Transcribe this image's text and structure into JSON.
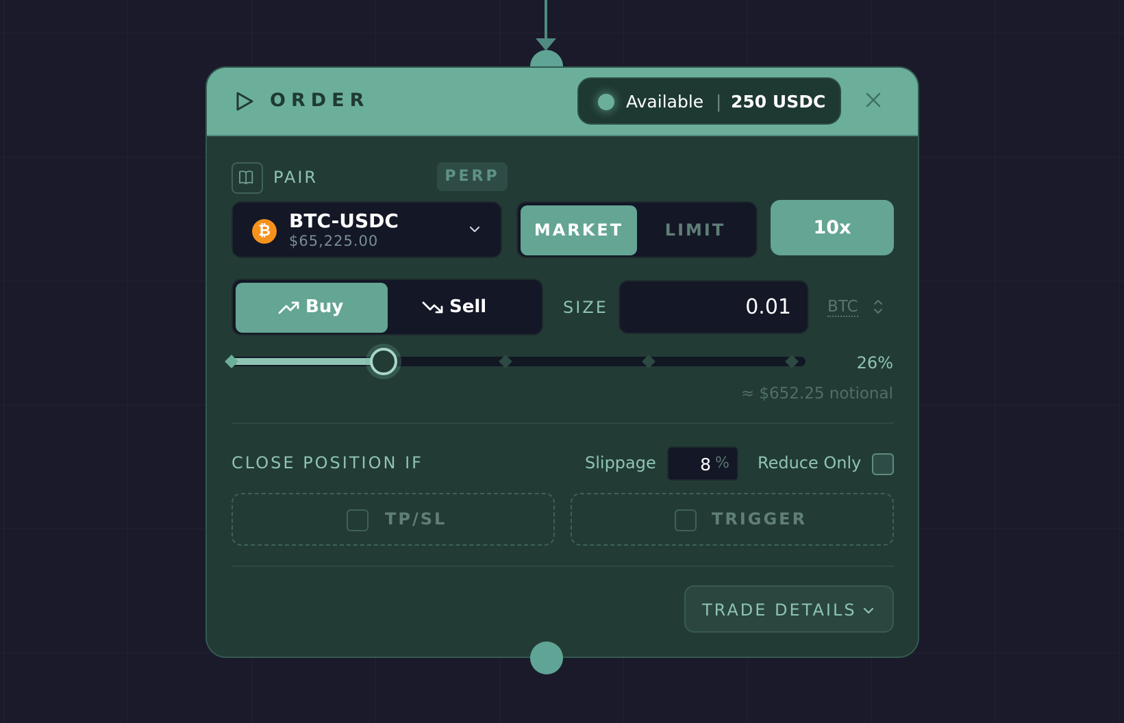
{
  "header": {
    "title": "ORDER",
    "available_label": "Available",
    "available_separator": "|",
    "available_value": "250 USDC"
  },
  "pair": {
    "label": "PAIR",
    "market_type": "PERP",
    "symbol": "BTC-USDC",
    "price": "$65,225.00",
    "icon_glyph": "₿"
  },
  "order_type": {
    "options": [
      "MARKET",
      "LIMIT"
    ],
    "selected": "MARKET"
  },
  "leverage": "10x",
  "side": {
    "options": [
      "Buy",
      "Sell"
    ],
    "selected": "Buy"
  },
  "size": {
    "label": "SIZE",
    "value": "0.01",
    "unit": "BTC"
  },
  "slider": {
    "percent_label": "26%",
    "percent_value": 26,
    "notional": "≈ $652.25 notional"
  },
  "close_position": {
    "label": "CLOSE POSITION IF",
    "slippage_label": "Slippage",
    "slippage_value": "8",
    "slippage_unit": "%",
    "reduce_only_label": "Reduce Only",
    "reduce_only_checked": false,
    "conditions": [
      "TP/SL",
      "TRIGGER"
    ]
  },
  "footer": {
    "trade_details_label": "TRADE DETAILS"
  },
  "colors": {
    "background": "#1b1a2a",
    "card": "#233b35",
    "header": "#6baf9b",
    "accent": "#64a594",
    "dark_field": "#131726",
    "bitcoin": "#f5921b"
  }
}
